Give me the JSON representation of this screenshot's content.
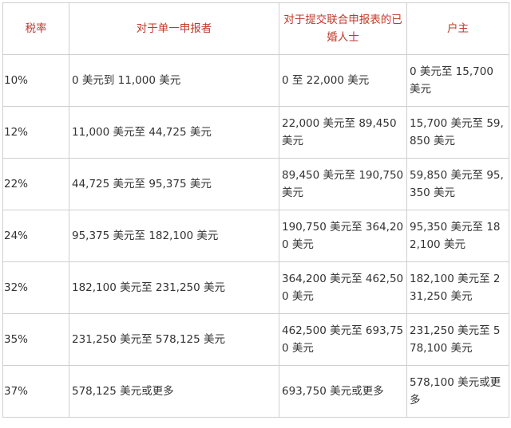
{
  "headers": [
    "税率",
    "对于单一申报者",
    "对于提交联合申报表的已婚人士",
    "户主"
  ],
  "rows": [
    [
      "10%",
      "0 美元到 11,000 美元",
      "0 至 22,000 美元",
      "0 美元至 15,700 美元"
    ],
    [
      "12%",
      "11,000 美元至 44,725 美元",
      "22,000 美元至 89,450 美元",
      "15,700 美元至 59,850 美元"
    ],
    [
      "22%",
      "44,725 美元至 95,375 美元",
      "89,450 美元至 190,750 美元",
      "59,850 美元至 95,350 美元"
    ],
    [
      "24%",
      "95,375 美元至 182,100 美元",
      "190,750 美元至 364,200 美元",
      "95,350 美元至 182,100 美元"
    ],
    [
      "32%",
      "182,100 美元至 231,250 美元",
      "364,200 美元至 462,500 美元",
      "182,100 美元至 231,250 美元"
    ],
    [
      "35%",
      "231,250 美元至 578,125 美元",
      "462,500 美元至 693,750 美元",
      "231,250 美元至 578,100 美元"
    ],
    [
      "37%",
      "578,125 美元或更多",
      "693,750 美元或更多",
      "578,100 美元或更多"
    ]
  ],
  "colors": {
    "header_text": "#c0392b",
    "cell_text": "#333333",
    "border": "#cfcfcf"
  }
}
